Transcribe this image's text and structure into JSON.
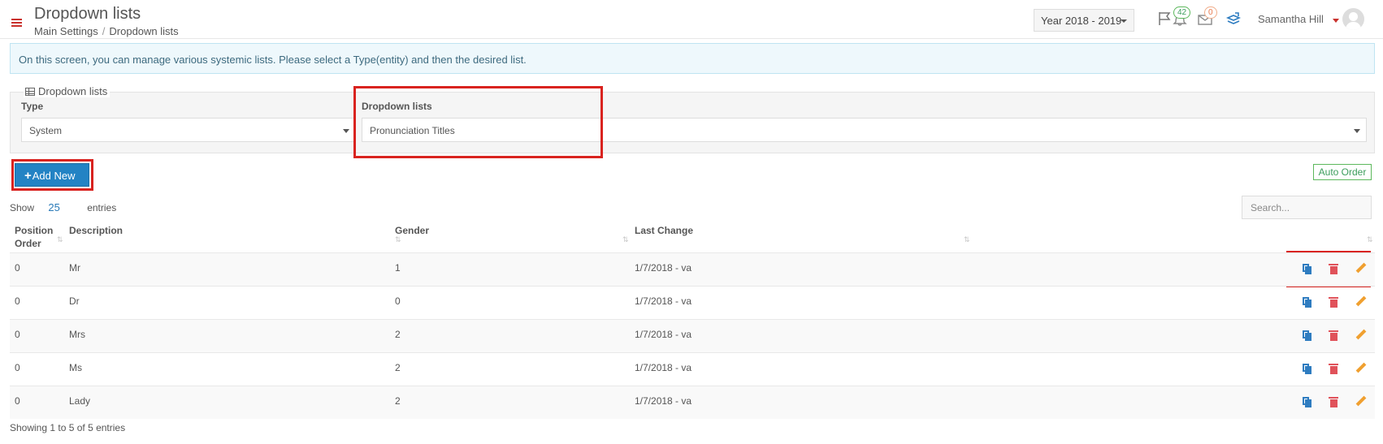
{
  "header": {
    "title": "Dropdown lists",
    "breadcrumb": [
      "Main Settings",
      "Dropdown lists"
    ],
    "year_select": "Year 2018 - 2019",
    "notifications_count": "42",
    "messages_count": "0",
    "user_name": "Samantha Hill"
  },
  "info_text": "On this screen, you can manage various systemic lists. Please select a Type(entity) and then the desired list.",
  "filter": {
    "legend": "Dropdown lists",
    "type_label": "Type",
    "type_value": "System",
    "list_label": "Dropdown lists",
    "list_value": "Pronunciation Titles"
  },
  "toolbar": {
    "add_new_plus": "+",
    "add_new_label": "Add New",
    "auto_order_label": "Auto Order",
    "show_label": "Show",
    "page_size": "25",
    "entries_label": "entries",
    "search_placeholder": "Search..."
  },
  "table": {
    "headers": [
      "Position Order",
      "Description",
      "Gender",
      "Last Change"
    ],
    "rows": [
      {
        "position": "0",
        "description": "Mr",
        "gender": "1",
        "last_change": "1/7/2018 - va"
      },
      {
        "position": "0",
        "description": "Dr",
        "gender": "0",
        "last_change": "1/7/2018 - va"
      },
      {
        "position": "0",
        "description": "Mrs",
        "gender": "2",
        "last_change": "1/7/2018 - va"
      },
      {
        "position": "0",
        "description": "Ms",
        "gender": "2",
        "last_change": "1/7/2018 - va"
      },
      {
        "position": "0",
        "description": "Lady",
        "gender": "2",
        "last_change": "1/7/2018 - va"
      }
    ]
  },
  "footer": {
    "showing_text": "Showing 1 to 5 of 5 entries"
  },
  "colors": {
    "accent": "#2383c4",
    "highlight": "#d9231f",
    "success": "#5cb85c",
    "danger": "#e0525a",
    "warning": "#f0a030"
  }
}
